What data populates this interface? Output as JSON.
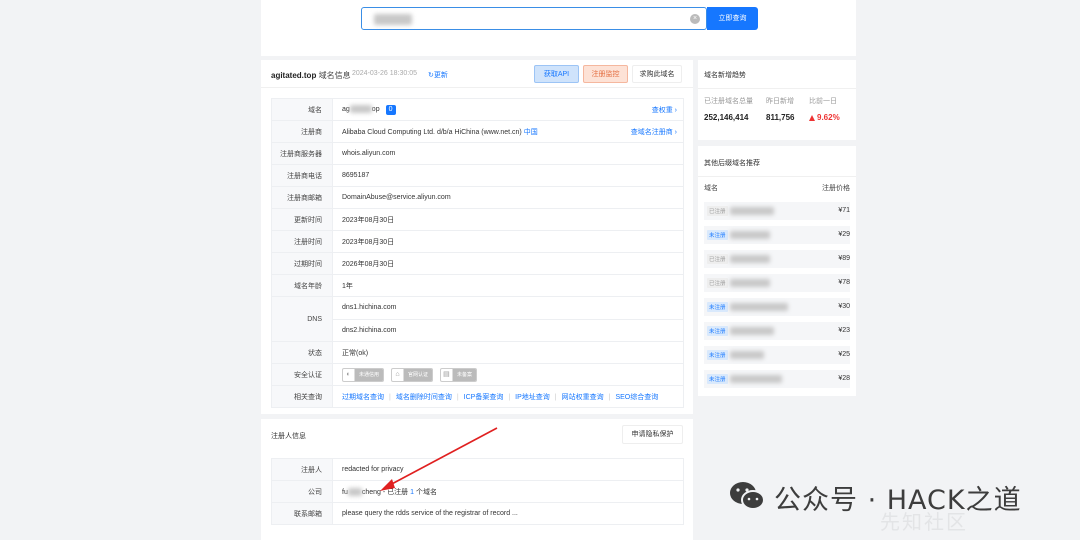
{
  "search": {
    "button_label": "立即查询"
  },
  "header": {
    "domain": "agitated.top",
    "domain_suffix_label": "域名信息",
    "query_time": "2024-03-26 18:30:05",
    "refresh_label": "更新",
    "api_label": "获取API",
    "monitor_label": "注册监控",
    "buy_label": "求购此域名"
  },
  "info": {
    "domain_label": "域名",
    "domain_prefix": "ag",
    "domain_suffix": "op",
    "domain_badge": "0",
    "domain_link": "查权重",
    "registrar_label": "注册商",
    "registrar_value": "Alibaba Cloud Computing Ltd. d/b/a HiChina (www.net.cn)",
    "registrar_country": "中国",
    "registrar_link": "查域名注册商",
    "server_label": "注册商服务器",
    "server_value": "whois.aliyun.com",
    "phone_label": "注册商电话",
    "phone_value": "8695187",
    "email_label": "注册商邮箱",
    "email_value": "DomainAbuse@service.aliyun.com",
    "updated_label": "更新时间",
    "updated_value": "2023年08月30日",
    "created_label": "注册时间",
    "created_value": "2023年08月30日",
    "expires_label": "过期时间",
    "expires_value": "2026年08月30日",
    "age_label": "域名年龄",
    "age_value": "1年",
    "dns_label": "DNS",
    "dns": [
      "dns1.hichina.com",
      "dns2.hichina.com"
    ],
    "status_label": "状态",
    "status_value": "正常(ok)",
    "security_label": "安全认证",
    "security_badges": [
      "未通信用",
      "官网认证",
      "未备案"
    ],
    "related_label": "相关查询",
    "related_links": [
      "过期域名查询",
      "域名删除时间查询",
      "ICP备案查询",
      "IP地址查询",
      "网站权重查询",
      "SEO综合查询"
    ]
  },
  "registrant": {
    "title": "注册人信息",
    "privacy_button": "申请隐私保护",
    "name_label": "注册人",
    "name_value": "redacted for privacy",
    "company_label": "公司",
    "company_prefix": "fu",
    "company_suffix": "cheng -",
    "company_registered_text": "已注册",
    "company_count": "1",
    "company_unit": "个域名",
    "contact_label": "联系邮箱",
    "contact_value": "please query the rdds service of the registrar of record ..."
  },
  "trend": {
    "title": "域名新增趋势",
    "total_label": "已注册域名总量",
    "total_value": "252,146,414",
    "new_label": "昨日新增",
    "new_value": "811,756",
    "ratio_label": "比前一日",
    "ratio_value": "9.62%"
  },
  "recommend": {
    "title": "其他后缀域名推荐",
    "col_domain": "域名",
    "col_price": "注册价格",
    "rows": [
      {
        "status": "已注册",
        "price": "¥71",
        "unregistered": false
      },
      {
        "status": "未注册",
        "price": "¥29",
        "unregistered": true
      },
      {
        "status": "已注册",
        "price": "¥89",
        "unregistered": false
      },
      {
        "status": "已注册",
        "price": "¥78",
        "unregistered": false
      },
      {
        "status": "未注册",
        "price": "¥30",
        "unregistered": true
      },
      {
        "status": "未注册",
        "price": "¥23",
        "unregistered": true
      },
      {
        "status": "未注册",
        "price": "¥25",
        "unregistered": true
      },
      {
        "status": "未注册",
        "price": "¥28",
        "unregistered": true
      }
    ]
  },
  "watermark": {
    "text": "公众号 · HACK之道",
    "shadow_text": "先知社区"
  },
  "colors": {
    "primary": "#1677ff",
    "increase": "#ee3333",
    "arrow": "#e02020"
  }
}
